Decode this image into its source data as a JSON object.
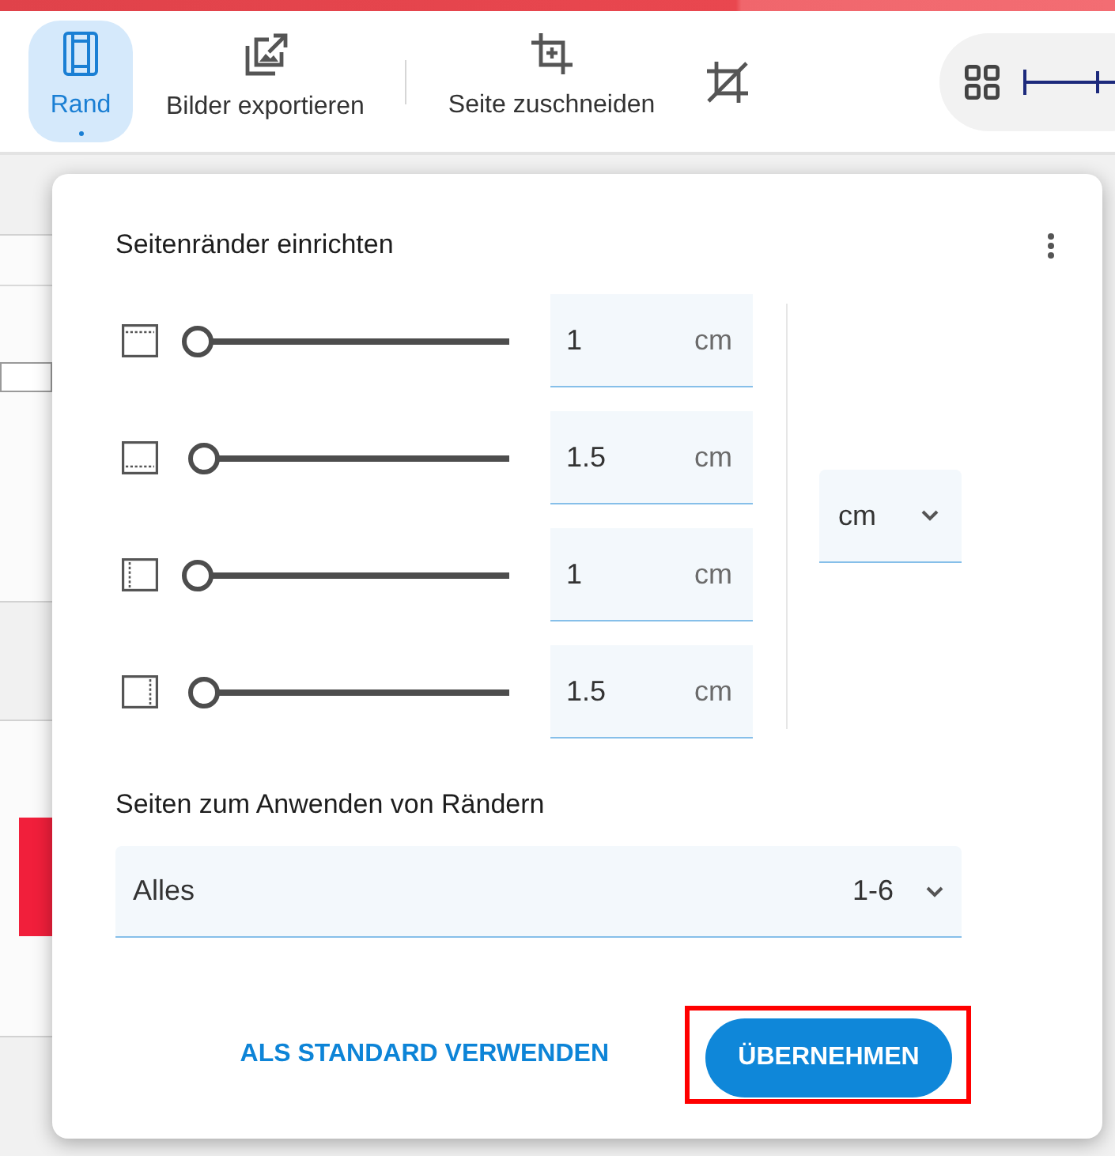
{
  "toolbar": {
    "items": [
      {
        "kind": "tool",
        "label": "Rand",
        "selected": true
      },
      {
        "kind": "tool",
        "label": "Bilder exportieren",
        "selected": false
      },
      {
        "kind": "divider"
      },
      {
        "kind": "tool",
        "label": "Seite zuschneiden",
        "selected": false
      },
      {
        "kind": "tool",
        "selected": false
      }
    ]
  },
  "dialog": {
    "title": "Seitenränder einrichten",
    "margins": [
      {
        "value": "1",
        "unit": "cm",
        "level": 0.03
      },
      {
        "value": "1.5",
        "unit": "cm",
        "level": 0.05
      },
      {
        "value": "1",
        "unit": "cm",
        "level": 0.03
      },
      {
        "value": "1.5",
        "unit": "cm",
        "level": 0.05
      }
    ],
    "unit_select": {
      "value": "cm"
    },
    "pages_label": "Seiten zum Anwenden von Rändern",
    "pages_select": {
      "value": "Alles",
      "range": "1-6"
    },
    "buttons": [
      {
        "kind": "text",
        "label": "ALS STANDARD VERWENDEN",
        "highlighted": false
      },
      {
        "kind": "filled",
        "label": "ÜBERNEHMEN",
        "highlighted": true
      }
    ]
  }
}
